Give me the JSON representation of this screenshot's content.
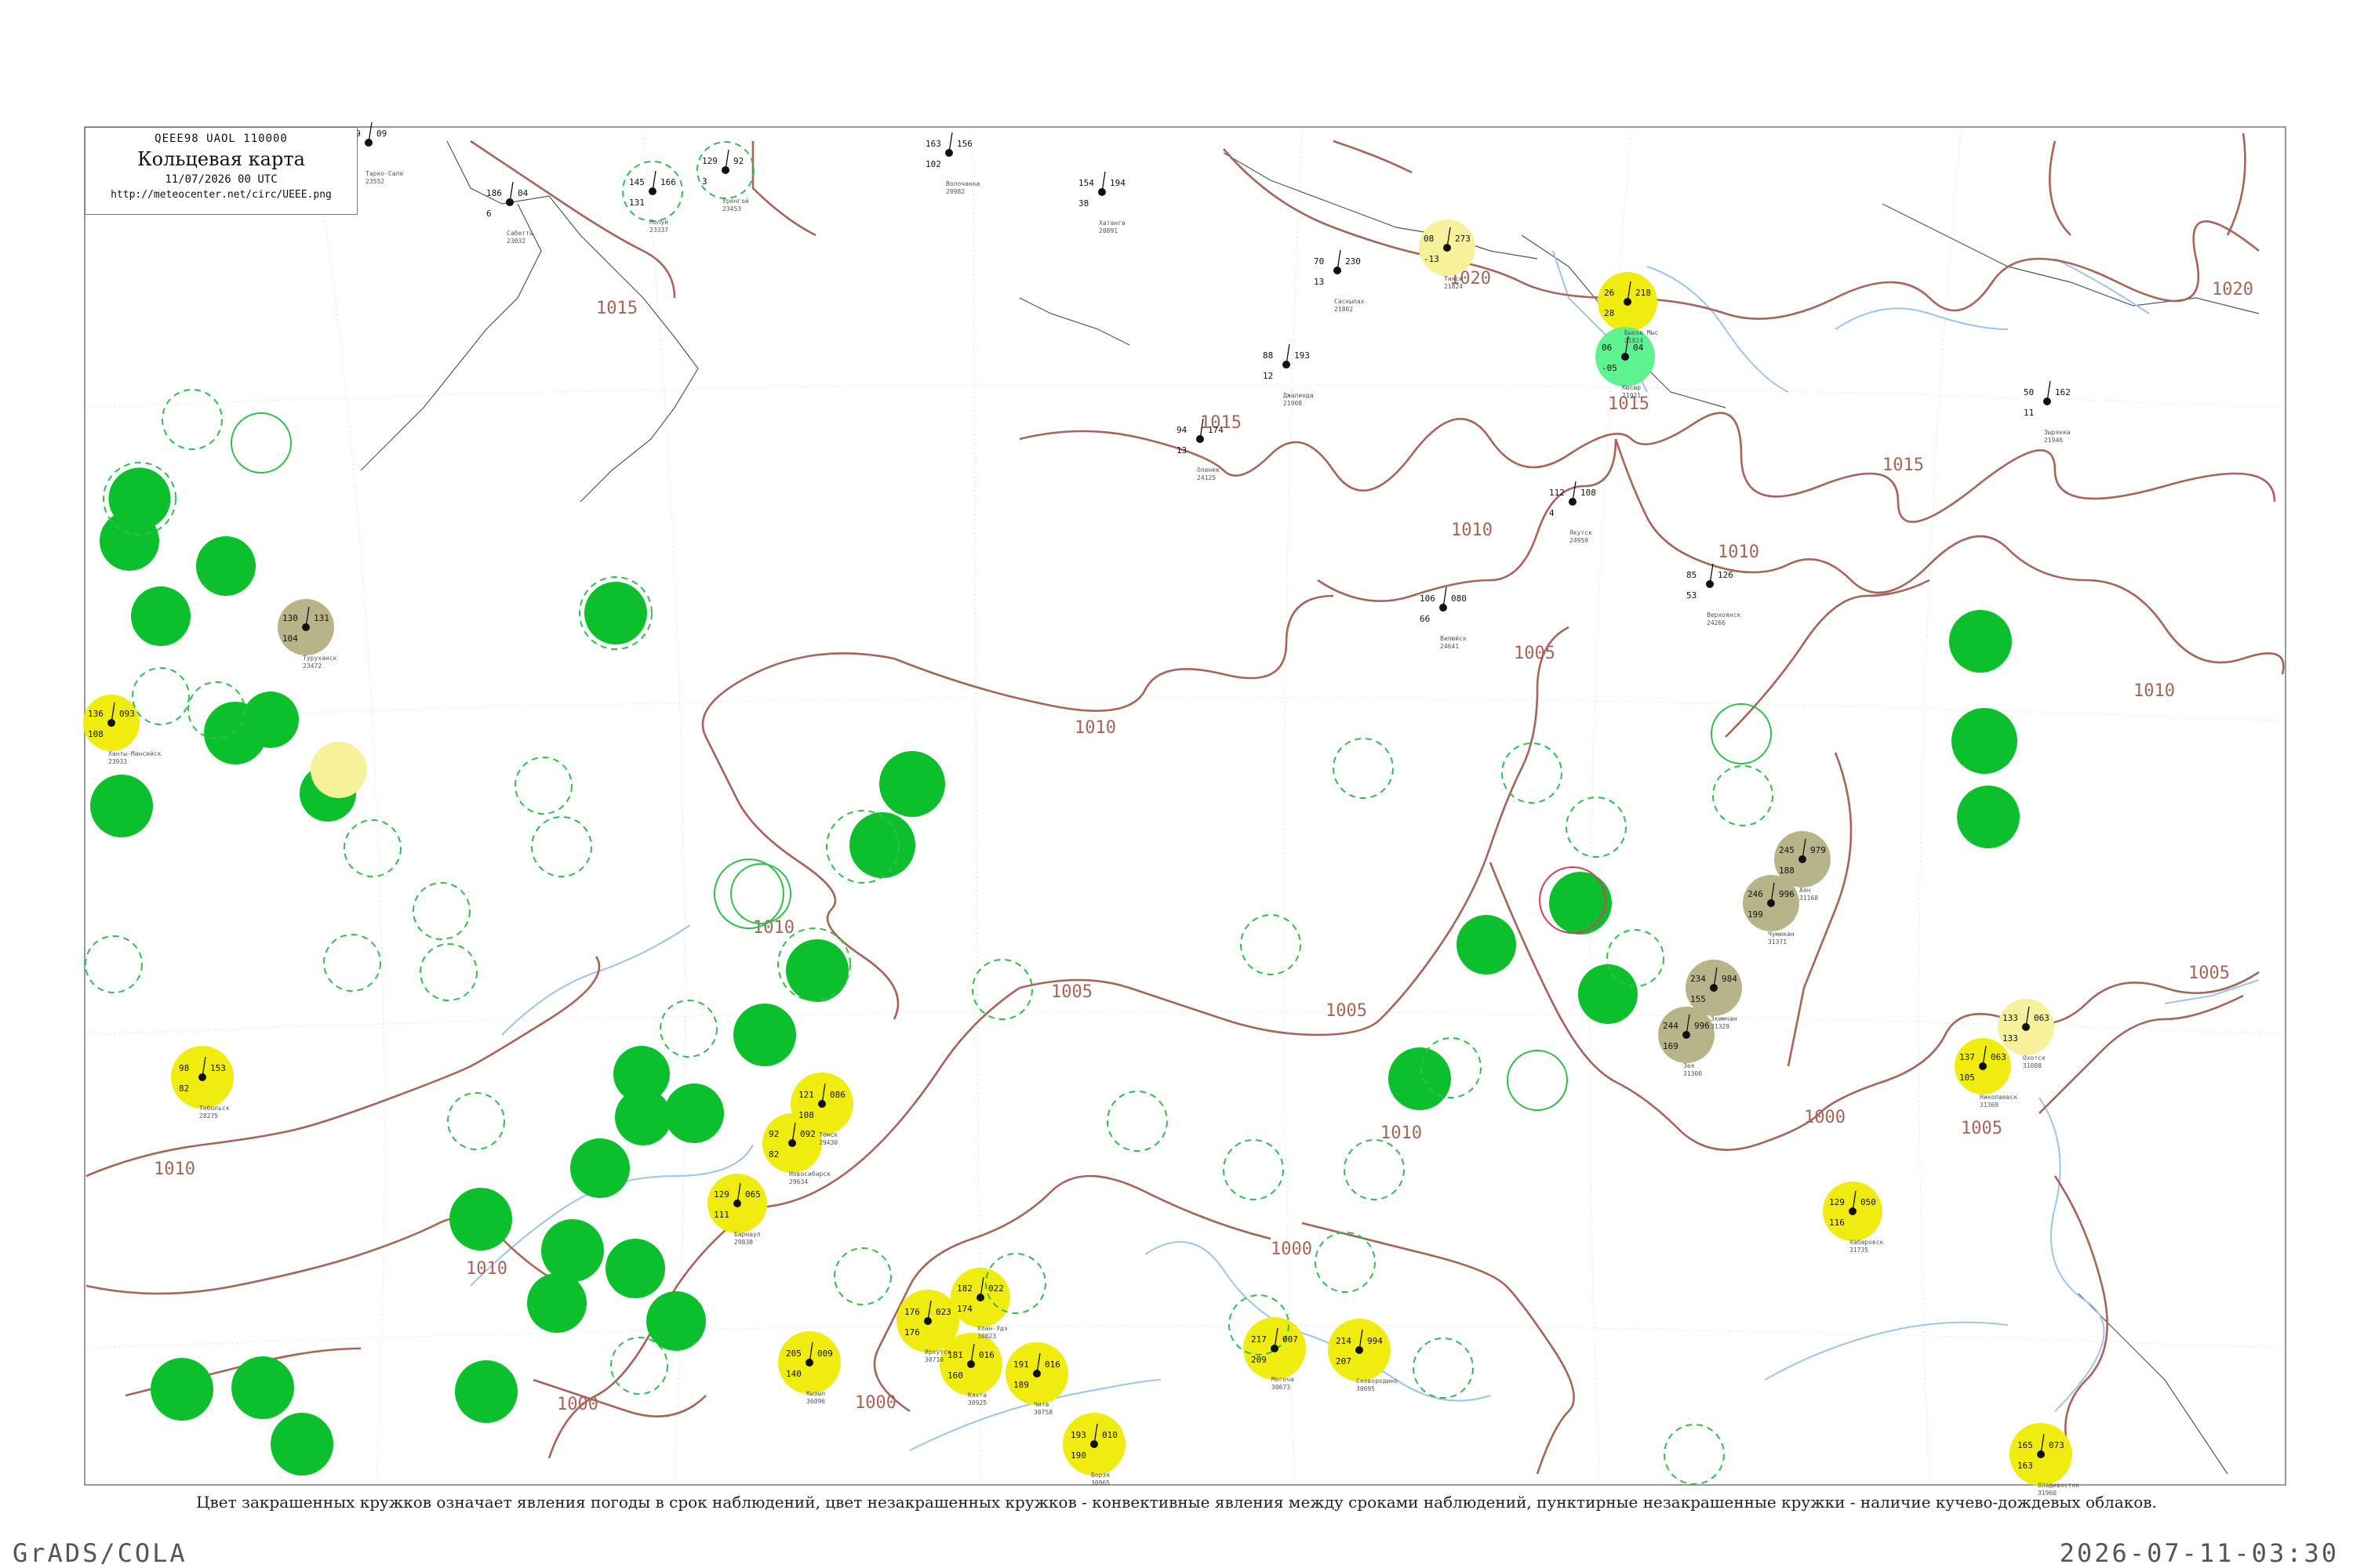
{
  "legend": {
    "code": "QEEE98 UAOL 110000",
    "title": "Кольцевая карта",
    "date": "11/07/2026 00 UTC",
    "url": "http://meteocenter.net/circ/UEEE.png"
  },
  "caption": "Цвет закрашенных кружков означает явления погоды в срок наблюдений, цвет незакрашенных кружков - конвективные явления между сроками наблюдений, пунктирные незакрашенные кружки - наличие кучево-дождевых облаков.",
  "footer": {
    "left": "GrADS/COLA",
    "right": "2026-07-11-03:30"
  },
  "colors": {
    "rain_green": "#0cbf2c",
    "convective_yellow": "#f0ec10",
    "pale_yellow": "#f6f19a",
    "olive": "#b8b48a",
    "mint": "#5ff290",
    "isobar": "#a86458",
    "river": "#9cc4ee"
  },
  "isobar_labels": [
    "1020",
    "1015",
    "1015",
    "1015",
    "1015",
    "1020",
    "1010",
    "1010",
    "1010",
    "1010",
    "1010",
    "1005",
    "1005",
    "1005",
    "1005",
    "1005",
    "1000",
    "1000",
    "1000",
    "1010",
    "1000",
    "1010",
    "1010"
  ],
  "stations": [
    {
      "name": "Тарко-Сале",
      "code": "23552",
      "a": "199",
      "b": "09",
      "c": "2",
      "fill": "none"
    },
    {
      "name": "Сабетта",
      "code": "23032",
      "a": "186",
      "b": "04",
      "c": "6",
      "fill": "none"
    },
    {
      "name": "Полуй",
      "code": "23337",
      "a": "145",
      "b": "166",
      "c": "131",
      "fill": "dashed"
    },
    {
      "name": "Уренгой",
      "code": "23453",
      "a": "129",
      "b": "92",
      "c": "3",
      "fill": "dashed"
    },
    {
      "name": "Волочанка",
      "code": "20982",
      "a": "163",
      "b": "156",
      "c": "102",
      "fill": "none"
    },
    {
      "name": "Хатанга",
      "code": "20891",
      "a": "154",
      "b": "194",
      "c": "38",
      "fill": "none"
    },
    {
      "name": "Саскылах",
      "code": "21802",
      "a": "70",
      "b": "230",
      "c": "13",
      "fill": "none"
    },
    {
      "name": "Тикси",
      "code": "21824",
      "a": "08",
      "b": "273",
      "c": "-13",
      "fill": "paleyellow"
    },
    {
      "name": "Быков Мыс",
      "code": "21824",
      "a": "26",
      "b": "218",
      "c": "28",
      "fill": "yellow"
    },
    {
      "name": "Кюсюр",
      "code": "21921",
      "a": "06",
      "b": "04",
      "c": "-05",
      "fill": "mint"
    },
    {
      "name": "Джалинда",
      "code": "21908",
      "a": "88",
      "b": "193",
      "c": "12",
      "fill": "none"
    },
    {
      "name": "Оленек",
      "code": "24125",
      "a": "94",
      "b": "174",
      "c": "13",
      "fill": "none"
    },
    {
      "name": "Зырянка",
      "code": "21946",
      "a": "50",
      "b": "162",
      "c": "11",
      "fill": "none"
    },
    {
      "name": "Верхоянск",
      "code": "24266",
      "a": "85",
      "b": "126",
      "c": "53",
      "fill": "none"
    },
    {
      "name": "Вилюйск",
      "code": "24641",
      "a": "106",
      "b": "080",
      "c": "66",
      "fill": "none"
    },
    {
      "name": "Якутск",
      "code": "24959",
      "a": "112",
      "b": "108",
      "c": "4",
      "fill": "none"
    },
    {
      "name": "Туруханск",
      "code": "23472",
      "a": "130",
      "b": "131",
      "c": "104",
      "fill": "olive"
    },
    {
      "name": "Ханты-Мансийск",
      "code": "23933",
      "a": "136",
      "b": "093",
      "c": "108",
      "fill": "yellow"
    },
    {
      "name": "Тобольск",
      "code": "28275",
      "a": "98",
      "b": "153",
      "c": "82",
      "fill": "yellow"
    },
    {
      "name": "Томск",
      "code": "29430",
      "a": "121",
      "b": "086",
      "c": "108",
      "fill": "yellow"
    },
    {
      "name": "Новосибирск",
      "code": "29634",
      "a": "92",
      "b": "092",
      "c": "82",
      "fill": "yellow"
    },
    {
      "name": "Барнаул",
      "code": "29838",
      "a": "129",
      "b": "065",
      "c": "111",
      "fill": "yellow"
    },
    {
      "name": "Кызыл",
      "code": "36096",
      "a": "205",
      "b": "009",
      "c": "140",
      "fill": "yellow"
    },
    {
      "name": "Иркутск",
      "code": "30710",
      "a": "176",
      "b": "023",
      "c": "176",
      "fill": "yellow"
    },
    {
      "name": "Улан-Удэ",
      "code": "30823",
      "a": "182",
      "b": "022",
      "c": "174",
      "fill": "yellow"
    },
    {
      "name": "Кяхта",
      "code": "30925",
      "a": "181",
      "b": "016",
      "c": "160",
      "fill": "yellow"
    },
    {
      "name": "Чита",
      "code": "30758",
      "a": "191",
      "b": "016",
      "c": "189",
      "fill": "yellow"
    },
    {
      "name": "Борзя",
      "code": "30965",
      "a": "193",
      "b": "010",
      "c": "190",
      "fill": "yellow"
    },
    {
      "name": "Могоча",
      "code": "30673",
      "a": "217",
      "b": "007",
      "c": "209",
      "fill": "yellow"
    },
    {
      "name": "Сковородино",
      "code": "30695",
      "a": "214",
      "b": "994",
      "c": "207",
      "fill": "yellow"
    },
    {
      "name": "Хабаровск",
      "code": "31735",
      "a": "129",
      "b": "050",
      "c": "116",
      "fill": "yellow"
    },
    {
      "name": "Николаевск",
      "code": "31369",
      "a": "137",
      "b": "063",
      "c": "105",
      "fill": "yellow"
    },
    {
      "name": "Охотск",
      "code": "31088",
      "a": "133",
      "b": "063",
      "c": "133",
      "fill": "paleyellow"
    },
    {
      "name": "Владивосток",
      "code": "31960",
      "a": "165",
      "b": "073",
      "c": "163",
      "fill": "yellow"
    },
    {
      "name": "Аян",
      "code": "31168",
      "a": "245",
      "b": "979",
      "c": "188",
      "fill": "olive"
    },
    {
      "name": "Чумикан",
      "code": "31371",
      "a": "246",
      "b": "996",
      "c": "199",
      "fill": "olive"
    },
    {
      "name": "Экимчан",
      "code": "31329",
      "a": "234",
      "b": "984",
      "c": "155",
      "fill": "olive"
    },
    {
      "name": "Зея",
      "code": "31300",
      "a": "244",
      "b": "996",
      "c": "169",
      "fill": "olive"
    }
  ]
}
